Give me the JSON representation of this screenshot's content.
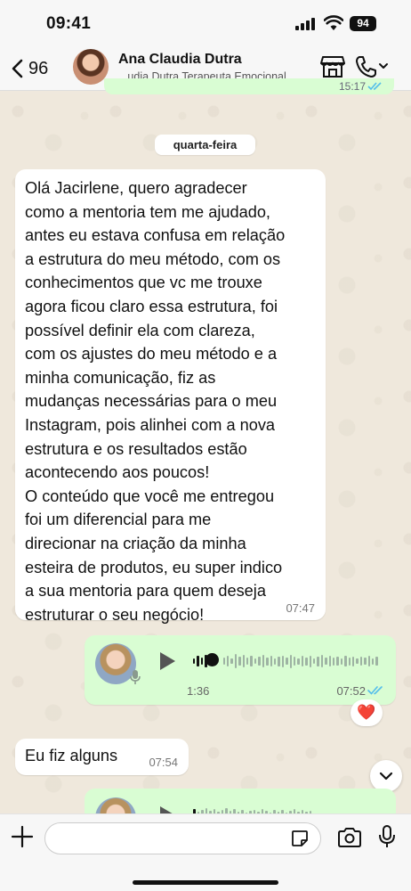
{
  "status_bar": {
    "time": "09:41",
    "battery": "94"
  },
  "header": {
    "back_count": "96",
    "contact_name": "Ana Claudia Dutra",
    "contact_subtitle": "...udia Dutra Terapeuta Emocional"
  },
  "chat": {
    "prev_time": "15:17",
    "day_label": "quarta-feira",
    "incoming_message": {
      "text": "Olá Jacirlene, quero agradecer\ncomo a mentoria tem me ajudado,\nantes eu estava confusa em relação\na estrutura do meu método, com os\nconhecimentos que vc me trouxe\nagora ficou claro essa estrutura, foi\npossível definir ela com clareza,\ncom os ajustes do meu método e a\nminha comunicação, fiz as\nmudanças necessárias para o meu\nInstagram, pois alinhei com a nova\nestrutura e os resultados estão\nacontecendo aos poucos!\nO conteúdo que você me entregou\nfoi um diferencial para me\ndirecionar na criação da minha\nesteira de produtos, eu super indico\na sua mentoria para quem deseja\nestruturar o seu negócio!",
      "time": "07:47"
    },
    "audio_message": {
      "duration": "1:36",
      "time": "07:52",
      "progress": 0.06,
      "reaction": "❤️"
    },
    "small_message": {
      "text": "Eu fiz alguns",
      "time": "07:54"
    }
  },
  "composer": {
    "placeholder": ""
  },
  "icons": {
    "back": "chevron-left-icon",
    "store": "store-icon",
    "call": "phone-icon",
    "plus": "plus-icon",
    "sticker": "sticker-icon",
    "camera": "camera-icon",
    "mic": "microphone-icon"
  },
  "colors": {
    "outgoing_bubble": "#d9fdd3",
    "incoming_bubble": "#ffffff",
    "background": "#efe8dd",
    "read_ticks": "#53bdeb"
  }
}
